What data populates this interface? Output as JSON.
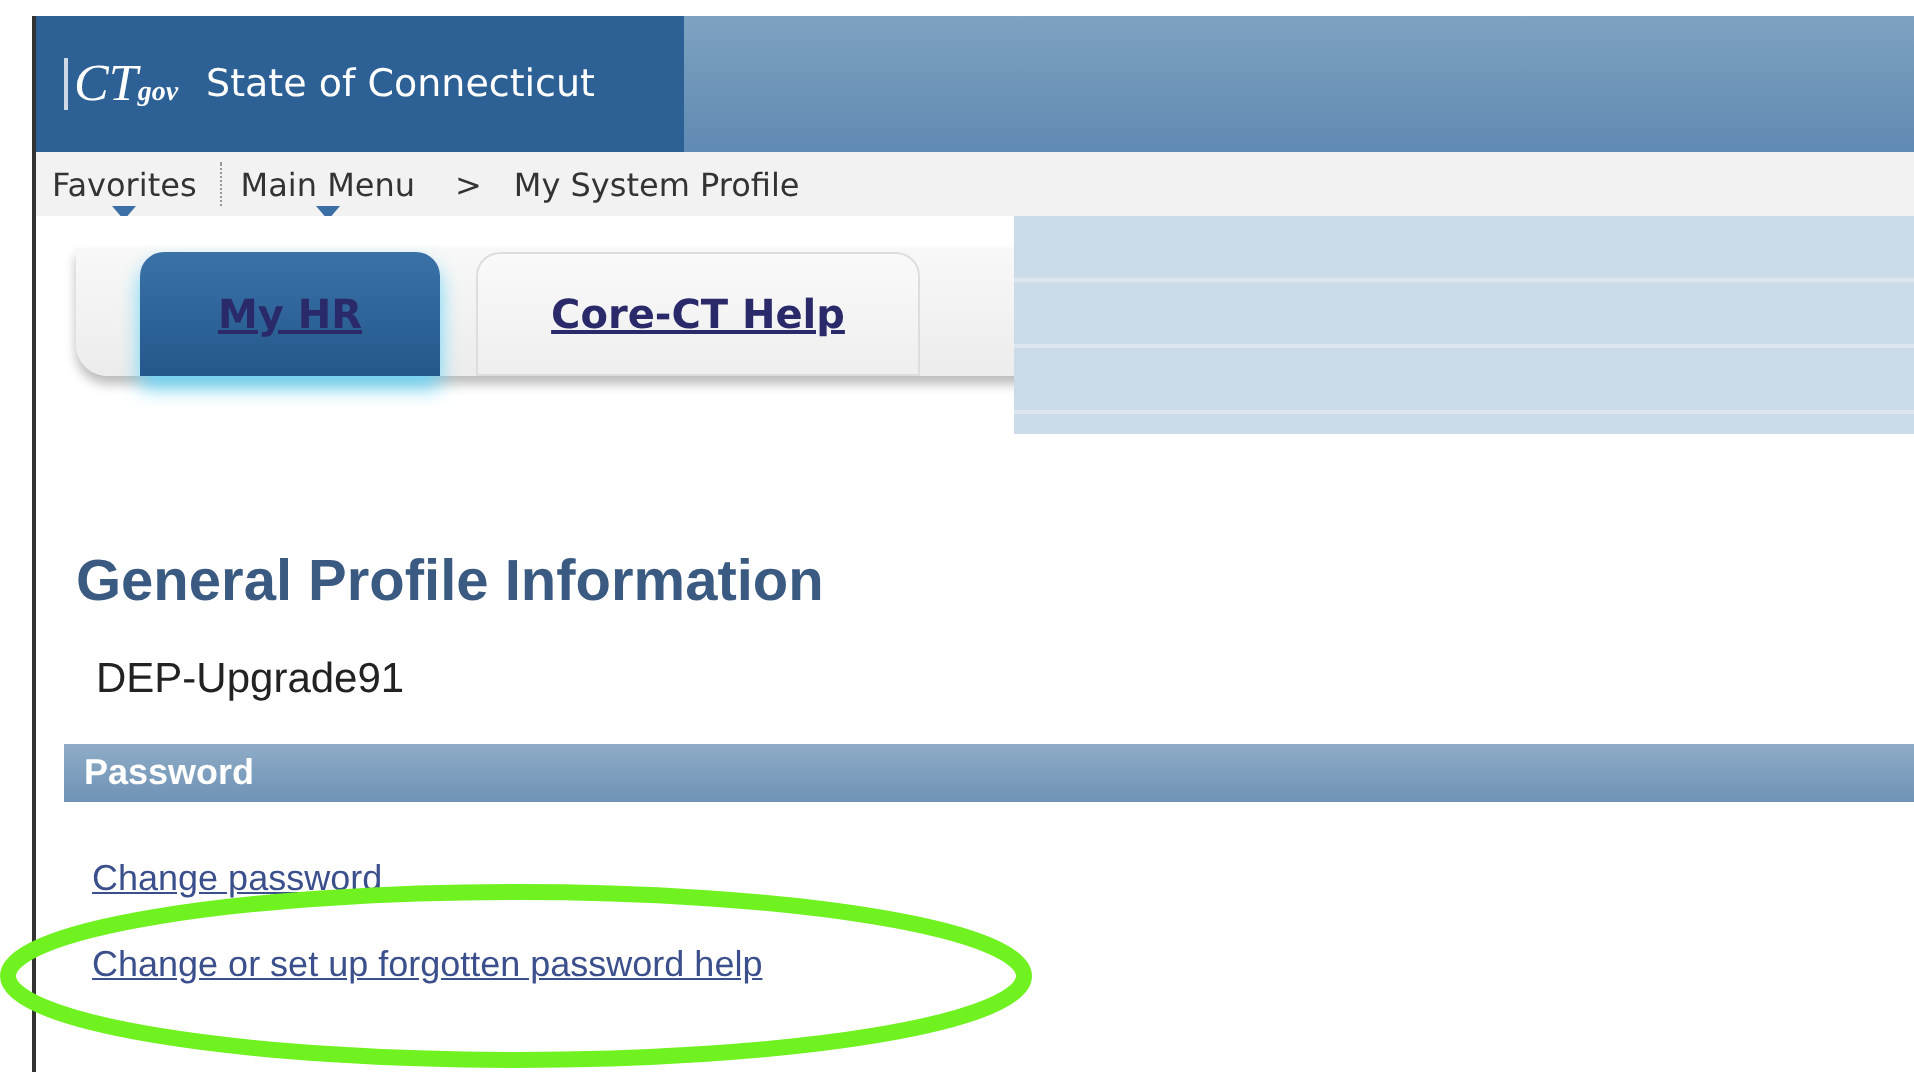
{
  "header": {
    "logo": {
      "main": "CT",
      "sub": "gov"
    },
    "title": "State of Connecticut"
  },
  "nav": {
    "menus": [
      {
        "label": "Favorites"
      },
      {
        "label": "Main Menu"
      }
    ],
    "separator": ">",
    "current": "My System Profile"
  },
  "tabs": [
    {
      "label": "My HR",
      "selected": true
    },
    {
      "label": "Core-CT Help",
      "selected": false
    }
  ],
  "page": {
    "heading": "General Profile Information",
    "user_id": "DEP-Upgrade91"
  },
  "section": {
    "title": "Password",
    "links": [
      "Change password",
      "Change or set up forgotten password help"
    ]
  },
  "annotation": {
    "kind": "ellipse",
    "color": "#6ff21f"
  }
}
